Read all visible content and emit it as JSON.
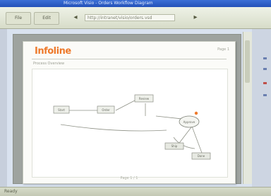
{
  "window": {
    "caption": "Microsoft Visio - Orders Workflow Diagram"
  },
  "toolbar": {
    "file_label": "File",
    "edit_label": "Edit",
    "address_value": "http://intranet/visio/orders.vsd",
    "go_icon": "go-arrow-icon",
    "back_icon": "back-arrow-icon"
  },
  "document": {
    "logo": "Infoline",
    "topright_note": "Page 1",
    "subheading": "Process Overview",
    "footer": "Page 1 / 1",
    "nodes": [
      {
        "label": "Start"
      },
      {
        "label": "Order"
      },
      {
        "label": "Review"
      },
      {
        "label": "Approve"
      },
      {
        "label": "Ship"
      },
      {
        "label": "Done"
      }
    ]
  },
  "status": {
    "text": "Ready"
  },
  "colors": {
    "accent": "#ee7a2c",
    "window_blue": "#2451b8"
  }
}
